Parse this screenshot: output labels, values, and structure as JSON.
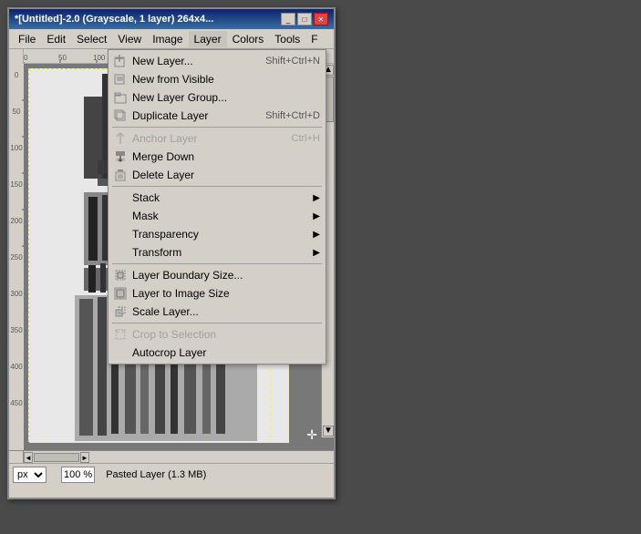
{
  "window": {
    "title": "*[Untitled]-2.0 (Grayscale, 1 layer) 264x4...",
    "minimize": "_",
    "maximize": "□",
    "close": "✕"
  },
  "menubar": {
    "items": [
      {
        "id": "file",
        "label": "File"
      },
      {
        "id": "edit",
        "label": "Edit"
      },
      {
        "id": "select",
        "label": "Select"
      },
      {
        "id": "view",
        "label": "View"
      },
      {
        "id": "image",
        "label": "Image"
      },
      {
        "id": "layer",
        "label": "Layer"
      },
      {
        "id": "colors",
        "label": "Colors"
      },
      {
        "id": "tools",
        "label": "Tools"
      },
      {
        "id": "filters",
        "label": "F"
      }
    ]
  },
  "layer_menu": {
    "items": [
      {
        "id": "new-layer",
        "label": "New Layer...",
        "shortcut": "Shift+Ctrl+N",
        "has_icon": true,
        "disabled": false
      },
      {
        "id": "new-from-visible",
        "label": "New from Visible",
        "shortcut": "",
        "has_icon": true,
        "disabled": false
      },
      {
        "id": "new-layer-group",
        "label": "New Layer Group...",
        "shortcut": "",
        "has_icon": true,
        "disabled": false
      },
      {
        "id": "duplicate-layer",
        "label": "Duplicate Layer",
        "shortcut": "Shift+Ctrl+D",
        "has_icon": true,
        "disabled": false
      },
      {
        "id": "sep1",
        "type": "separator"
      },
      {
        "id": "anchor-layer",
        "label": "Anchor Layer",
        "shortcut": "Ctrl+H",
        "has_icon": true,
        "disabled": true
      },
      {
        "id": "merge-down",
        "label": "Merge Down",
        "shortcut": "",
        "has_icon": true,
        "disabled": false
      },
      {
        "id": "delete-layer",
        "label": "Delete Layer",
        "shortcut": "",
        "has_icon": true,
        "disabled": false
      },
      {
        "id": "sep2",
        "type": "separator"
      },
      {
        "id": "stack",
        "label": "Stack",
        "shortcut": "",
        "has_submenu": true,
        "disabled": false
      },
      {
        "id": "mask",
        "label": "Mask",
        "shortcut": "",
        "has_submenu": true,
        "disabled": false
      },
      {
        "id": "transparency",
        "label": "Transparency",
        "shortcut": "",
        "has_submenu": true,
        "disabled": false
      },
      {
        "id": "transform",
        "label": "Transform",
        "shortcut": "",
        "has_submenu": true,
        "disabled": false
      },
      {
        "id": "sep3",
        "type": "separator"
      },
      {
        "id": "layer-boundary-size",
        "label": "Layer Boundary Size...",
        "shortcut": "",
        "has_icon": true,
        "disabled": false
      },
      {
        "id": "layer-to-image-size",
        "label": "Layer to Image Size",
        "shortcut": "",
        "has_icon": true,
        "disabled": false
      },
      {
        "id": "scale-layer",
        "label": "Scale Layer...",
        "shortcut": "",
        "has_icon": true,
        "disabled": false
      },
      {
        "id": "sep4",
        "type": "separator"
      },
      {
        "id": "crop-to-selection",
        "label": "Crop to Selection",
        "shortcut": "",
        "has_icon": true,
        "disabled": true
      },
      {
        "id": "autocrop-layer",
        "label": "Autocrop Layer",
        "shortcut": "",
        "disabled": false
      }
    ]
  },
  "statusbar": {
    "unit": "px",
    "zoom": "100 %",
    "info": "Pasted Layer (1.3 MB)"
  }
}
